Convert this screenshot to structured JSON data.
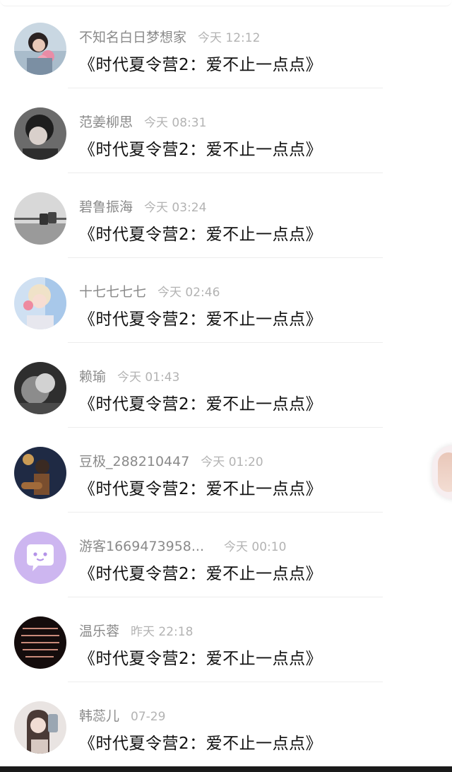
{
  "messages": [
    {
      "name": "不知名白日梦想家",
      "time": "今天 12:12",
      "text": "《时代夏令营2：爱不止一点点》"
    },
    {
      "name": "范姜柳思",
      "time": "今天 08:31",
      "text": "《时代夏令营2：爱不止一点点》"
    },
    {
      "name": "碧鲁振海",
      "time": "今天 03:24",
      "text": "《时代夏令营2：爱不止一点点》"
    },
    {
      "name": "十七七七七",
      "time": "今天 02:46",
      "text": "《时代夏令营2：爱不止一点点》"
    },
    {
      "name": "赖瑜",
      "time": "今天 01:43",
      "text": "《时代夏令营2：爱不止一点点》"
    },
    {
      "name": "豆极_288210447",
      "time": "今天 01:20",
      "text": "《时代夏令营2：爱不止一点点》"
    },
    {
      "name": "游客1669473958...",
      "time": "今天 00:10",
      "text": "《时代夏令营2：爱不止一点点》"
    },
    {
      "name": "温乐蓉",
      "time": "昨天 22:18",
      "text": "《时代夏令营2：爱不止一点点》"
    },
    {
      "name": "韩蕊儿",
      "time": "07-29",
      "text": "《时代夏令营2：爱不止一点点》"
    }
  ],
  "colors": {
    "name_text": "#8a8a8a",
    "time_text": "#b3b3b3",
    "message_text": "#111111",
    "guest_avatar_bg": "#cdb6f0",
    "divider": "#ededed"
  },
  "icons": [
    "guest-chat-bubble-icon"
  ]
}
